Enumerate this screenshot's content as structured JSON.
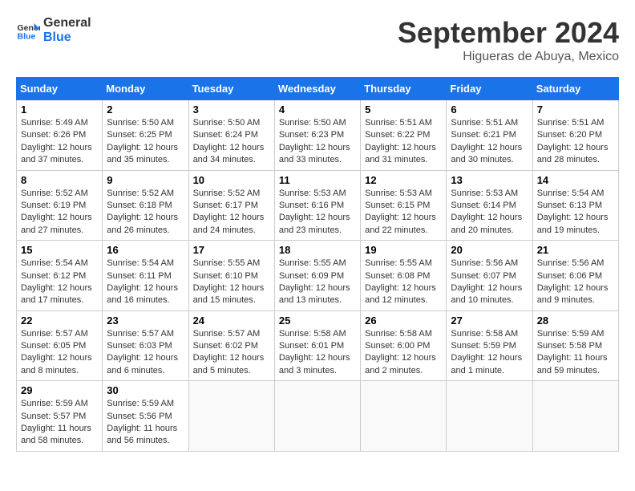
{
  "header": {
    "logo_line1": "General",
    "logo_line2": "Blue",
    "month": "September 2024",
    "location": "Higueras de Abuya, Mexico"
  },
  "columns": [
    "Sunday",
    "Monday",
    "Tuesday",
    "Wednesday",
    "Thursday",
    "Friday",
    "Saturday"
  ],
  "weeks": [
    [
      {
        "day": "1",
        "sunrise": "5:49 AM",
        "sunset": "6:26 PM",
        "daylight": "12 hours and 37 minutes."
      },
      {
        "day": "2",
        "sunrise": "5:50 AM",
        "sunset": "6:25 PM",
        "daylight": "12 hours and 35 minutes."
      },
      {
        "day": "3",
        "sunrise": "5:50 AM",
        "sunset": "6:24 PM",
        "daylight": "12 hours and 34 minutes."
      },
      {
        "day": "4",
        "sunrise": "5:50 AM",
        "sunset": "6:23 PM",
        "daylight": "12 hours and 33 minutes."
      },
      {
        "day": "5",
        "sunrise": "5:51 AM",
        "sunset": "6:22 PM",
        "daylight": "12 hours and 31 minutes."
      },
      {
        "day": "6",
        "sunrise": "5:51 AM",
        "sunset": "6:21 PM",
        "daylight": "12 hours and 30 minutes."
      },
      {
        "day": "7",
        "sunrise": "5:51 AM",
        "sunset": "6:20 PM",
        "daylight": "12 hours and 28 minutes."
      }
    ],
    [
      {
        "day": "8",
        "sunrise": "5:52 AM",
        "sunset": "6:19 PM",
        "daylight": "12 hours and 27 minutes."
      },
      {
        "day": "9",
        "sunrise": "5:52 AM",
        "sunset": "6:18 PM",
        "daylight": "12 hours and 26 minutes."
      },
      {
        "day": "10",
        "sunrise": "5:52 AM",
        "sunset": "6:17 PM",
        "daylight": "12 hours and 24 minutes."
      },
      {
        "day": "11",
        "sunrise": "5:53 AM",
        "sunset": "6:16 PM",
        "daylight": "12 hours and 23 minutes."
      },
      {
        "day": "12",
        "sunrise": "5:53 AM",
        "sunset": "6:15 PM",
        "daylight": "12 hours and 22 minutes."
      },
      {
        "day": "13",
        "sunrise": "5:53 AM",
        "sunset": "6:14 PM",
        "daylight": "12 hours and 20 minutes."
      },
      {
        "day": "14",
        "sunrise": "5:54 AM",
        "sunset": "6:13 PM",
        "daylight": "12 hours and 19 minutes."
      }
    ],
    [
      {
        "day": "15",
        "sunrise": "5:54 AM",
        "sunset": "6:12 PM",
        "daylight": "12 hours and 17 minutes."
      },
      {
        "day": "16",
        "sunrise": "5:54 AM",
        "sunset": "6:11 PM",
        "daylight": "12 hours and 16 minutes."
      },
      {
        "day": "17",
        "sunrise": "5:55 AM",
        "sunset": "6:10 PM",
        "daylight": "12 hours and 15 minutes."
      },
      {
        "day": "18",
        "sunrise": "5:55 AM",
        "sunset": "6:09 PM",
        "daylight": "12 hours and 13 minutes."
      },
      {
        "day": "19",
        "sunrise": "5:55 AM",
        "sunset": "6:08 PM",
        "daylight": "12 hours and 12 minutes."
      },
      {
        "day": "20",
        "sunrise": "5:56 AM",
        "sunset": "6:07 PM",
        "daylight": "12 hours and 10 minutes."
      },
      {
        "day": "21",
        "sunrise": "5:56 AM",
        "sunset": "6:06 PM",
        "daylight": "12 hours and 9 minutes."
      }
    ],
    [
      {
        "day": "22",
        "sunrise": "5:57 AM",
        "sunset": "6:05 PM",
        "daylight": "12 hours and 8 minutes."
      },
      {
        "day": "23",
        "sunrise": "5:57 AM",
        "sunset": "6:03 PM",
        "daylight": "12 hours and 6 minutes."
      },
      {
        "day": "24",
        "sunrise": "5:57 AM",
        "sunset": "6:02 PM",
        "daylight": "12 hours and 5 minutes."
      },
      {
        "day": "25",
        "sunrise": "5:58 AM",
        "sunset": "6:01 PM",
        "daylight": "12 hours and 3 minutes."
      },
      {
        "day": "26",
        "sunrise": "5:58 AM",
        "sunset": "6:00 PM",
        "daylight": "12 hours and 2 minutes."
      },
      {
        "day": "27",
        "sunrise": "5:58 AM",
        "sunset": "5:59 PM",
        "daylight": "12 hours and 1 minute."
      },
      {
        "day": "28",
        "sunrise": "5:59 AM",
        "sunset": "5:58 PM",
        "daylight": "11 hours and 59 minutes."
      }
    ],
    [
      {
        "day": "29",
        "sunrise": "5:59 AM",
        "sunset": "5:57 PM",
        "daylight": "11 hours and 58 minutes."
      },
      {
        "day": "30",
        "sunrise": "5:59 AM",
        "sunset": "5:56 PM",
        "daylight": "11 hours and 56 minutes."
      },
      null,
      null,
      null,
      null,
      null
    ]
  ]
}
